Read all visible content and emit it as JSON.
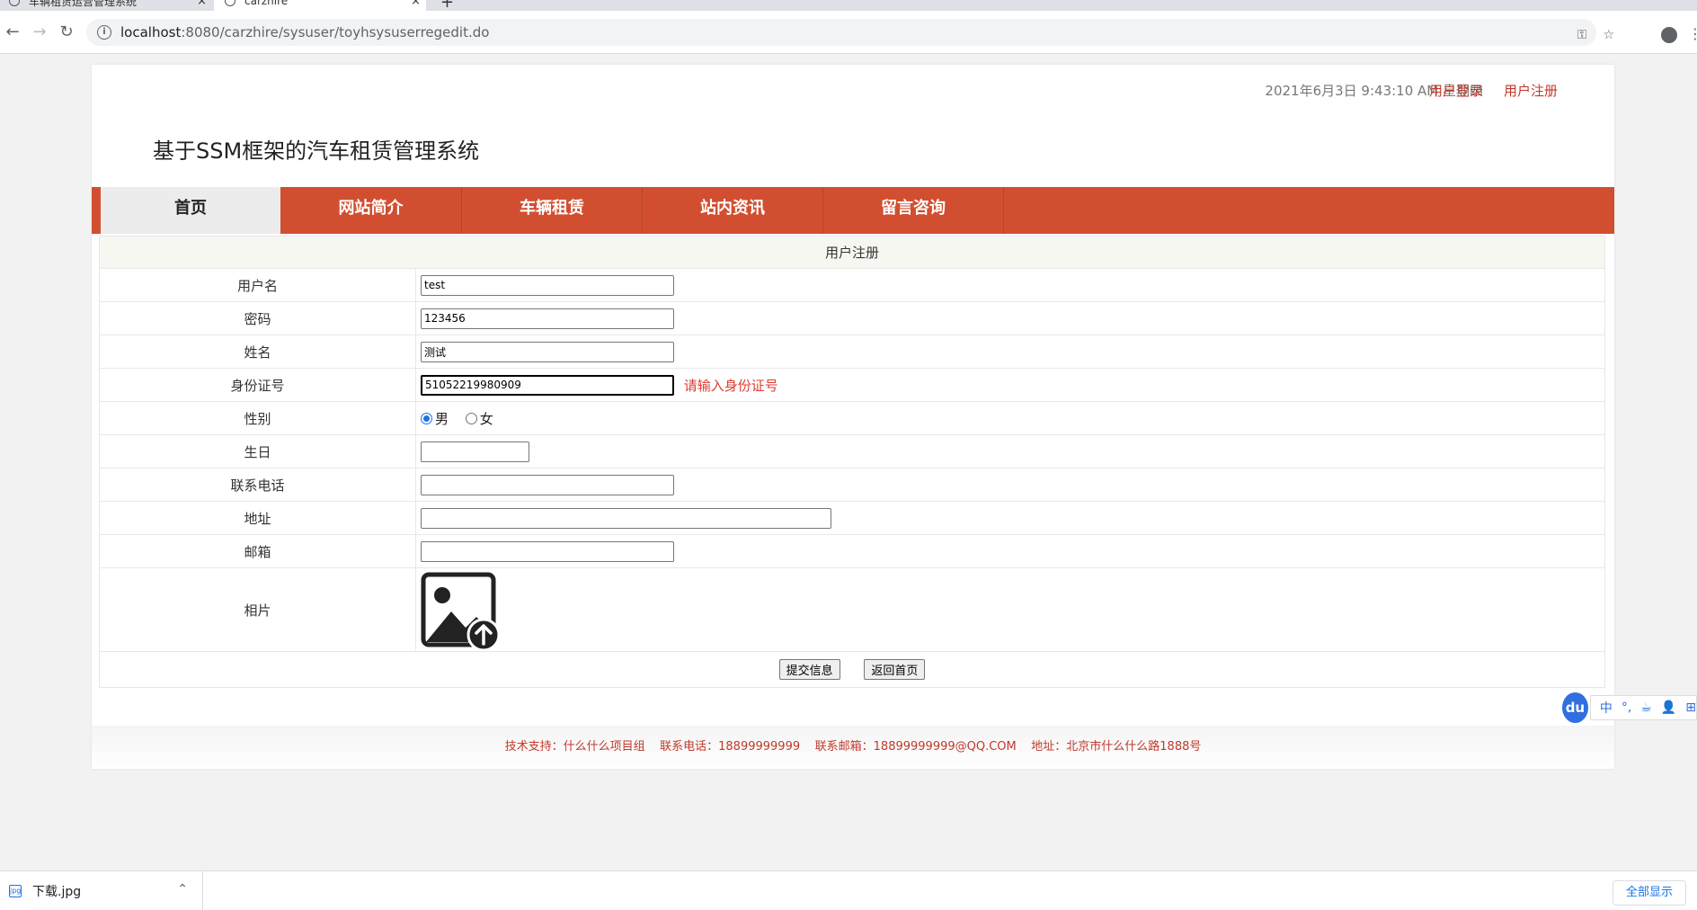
{
  "browser": {
    "tabs": [
      {
        "title": "车辆租赁运营管理系统",
        "close": "×"
      },
      {
        "title": "carzhire",
        "close": "×"
      }
    ],
    "new_tab": "+",
    "url_host": "localhost",
    "url_path": ":8080/carzhire/sysuser/toyhsysuserregedit.do"
  },
  "header": {
    "datetime": "2021年6月3日 9:43:10 AM 星期四",
    "login_link": "用户登录",
    "register_link": "用户注册",
    "site_title": "基于SSM框架的汽车租赁管理系统"
  },
  "nav": {
    "items": [
      {
        "label": "首页",
        "active": true
      },
      {
        "label": "网站简介",
        "active": false
      },
      {
        "label": "车辆租赁",
        "active": false
      },
      {
        "label": "站内资讯",
        "active": false
      },
      {
        "label": "留言咨询",
        "active": false
      }
    ]
  },
  "form": {
    "title": "用户注册",
    "labels": {
      "username": "用户名",
      "password": "密码",
      "name": "姓名",
      "idcard": "身份证号",
      "gender": "性别",
      "birthday": "生日",
      "phone": "联系电话",
      "address": "地址",
      "email": "邮箱",
      "photo": "相片"
    },
    "values": {
      "username": "test",
      "password": "123456",
      "name": "测试",
      "idcard": "51052219980909",
      "birthday": "",
      "phone": "",
      "address": "",
      "email": ""
    },
    "idcard_error": "请输入身份证号",
    "gender_options": [
      "男",
      "女"
    ],
    "gender_selected": "男",
    "submit_label": "提交信息",
    "back_label": "返回首页"
  },
  "footer": {
    "text": "技术支持：什么什么项目组    联系电话：18899999999    联系邮箱：18899999999@QQ.COM    地址：北京市什么什么路1888号"
  },
  "ime": {
    "logo": "du",
    "items": [
      "中",
      "°,",
      "☕",
      "👤",
      "⊞"
    ]
  },
  "downloads": {
    "file_name": "下载.jpg",
    "show_all": "全部显示"
  },
  "colors": {
    "nav_bg": "#d14f30",
    "link": "#c0392b",
    "error": "#e03c31"
  }
}
